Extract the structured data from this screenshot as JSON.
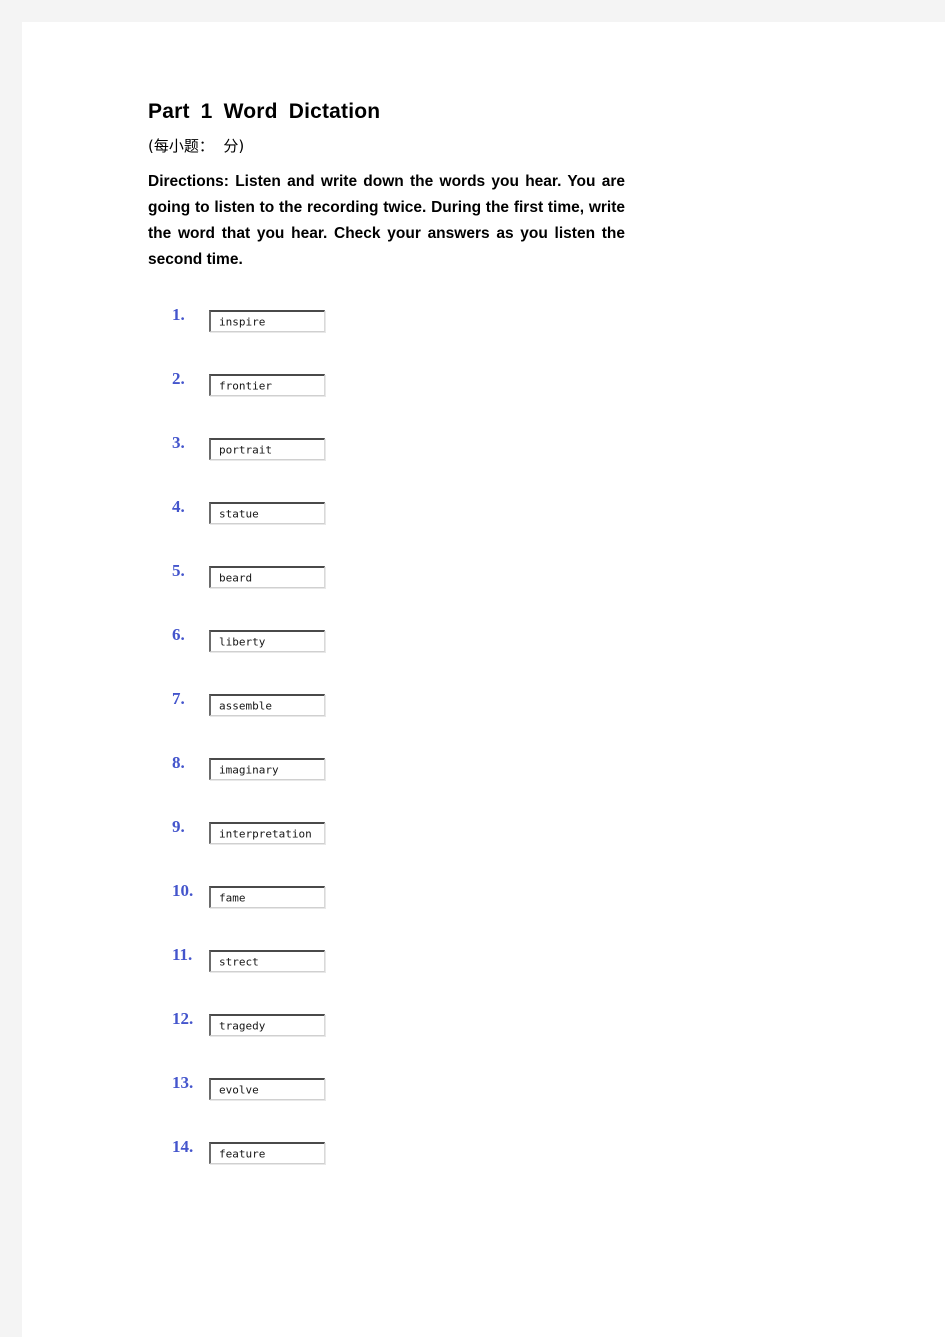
{
  "document": {
    "title": "Part 1 Word Dictation",
    "score_line": "(每小题：  分)",
    "directions": "Directions: Listen and write down the words you hear. You are going to listen to the recording twice. During the first time, write the word that you hear. Check your answers as you listen the second time."
  },
  "colors": {
    "number": "#4455cc",
    "page_background": "#ffffff",
    "canvas_background": "#f4f4f4",
    "text": "#000000"
  },
  "items": [
    {
      "number": "1.",
      "answer": "inspire"
    },
    {
      "number": "2.",
      "answer": "frontier"
    },
    {
      "number": "3.",
      "answer": "portrait"
    },
    {
      "number": "4.",
      "answer": "statue"
    },
    {
      "number": "5.",
      "answer": "beard"
    },
    {
      "number": "6.",
      "answer": "liberty"
    },
    {
      "number": "7.",
      "answer": "assemble"
    },
    {
      "number": "8.",
      "answer": "imaginary"
    },
    {
      "number": "9.",
      "answer": "interpretation"
    },
    {
      "number": "10.",
      "answer": "fame"
    },
    {
      "number": "11.",
      "answer": "strect"
    },
    {
      "number": "12.",
      "answer": "tragedy"
    },
    {
      "number": "13.",
      "answer": "evolve"
    },
    {
      "number": "14.",
      "answer": "feature"
    }
  ]
}
